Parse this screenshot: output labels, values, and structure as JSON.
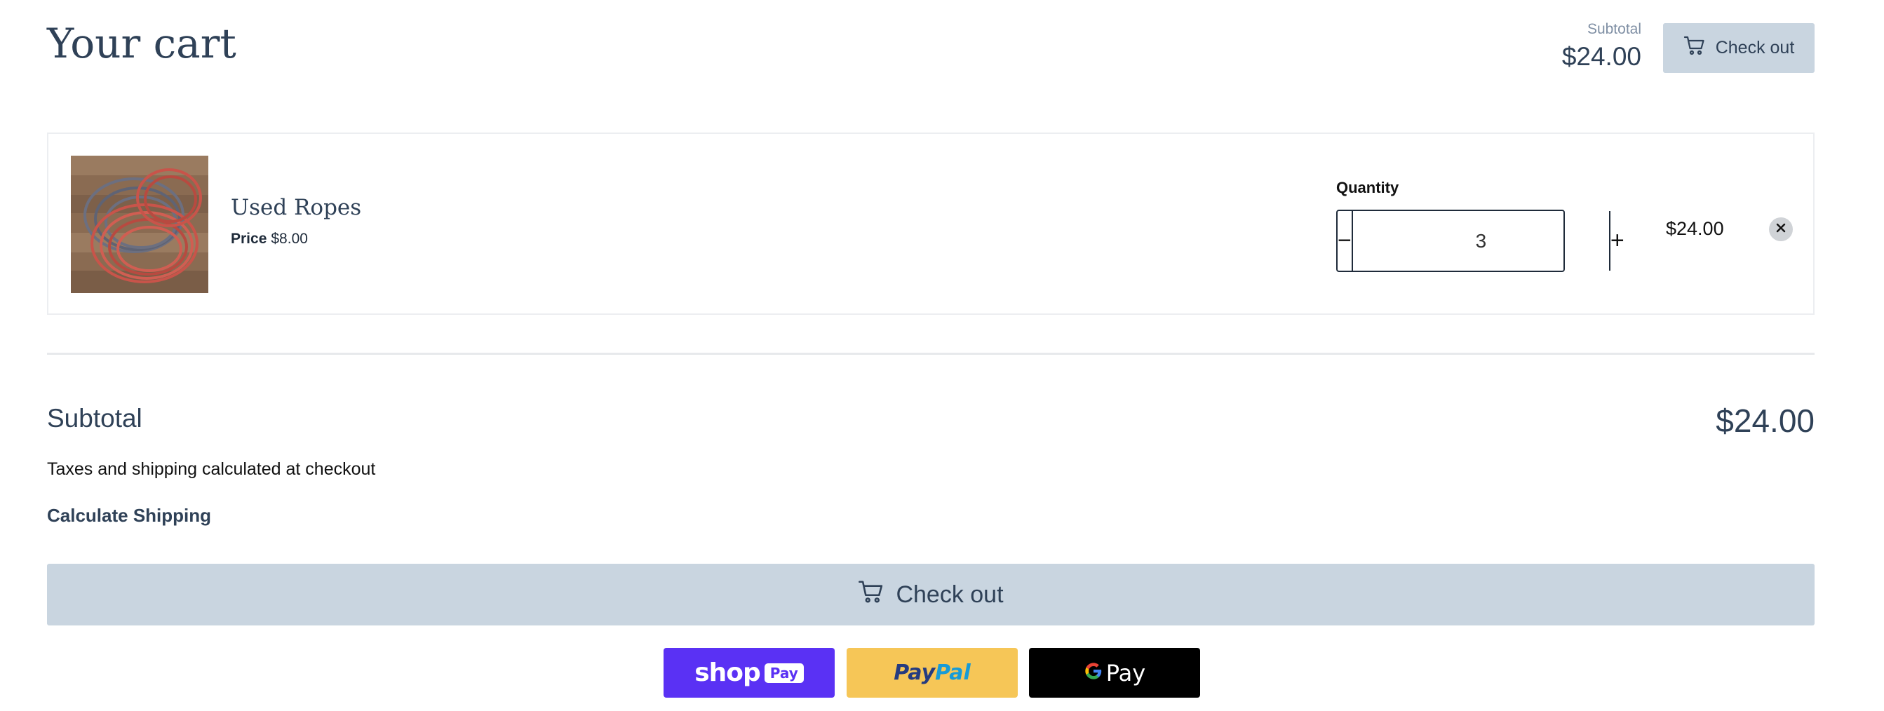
{
  "header": {
    "title": "Your cart",
    "subtotal_label": "Subtotal",
    "subtotal_value": "$24.00",
    "checkout_label": "Check out",
    "checkout_icon": "cart-icon"
  },
  "cart": {
    "items": [
      {
        "title": "Used Ropes",
        "price_label": "Price",
        "price_value": "$8.00",
        "quantity_label": "Quantity",
        "quantity": "3",
        "decrement_symbol": "−",
        "increment_symbol": "+",
        "line_total": "$24.00",
        "remove_icon": "close-icon"
      }
    ]
  },
  "summary": {
    "subtotal_label": "Subtotal",
    "subtotal_value": "$24.00",
    "tax_note": "Taxes and shipping calculated at checkout",
    "calculate_shipping": "Calculate Shipping",
    "checkout_label": "Check out"
  },
  "payment": {
    "shop_pay": {
      "word": "shop",
      "pill": "Pay"
    },
    "paypal": {
      "part1": "Pay",
      "part2": "Pal"
    },
    "google_pay": {
      "g": "G",
      "word": "Pay"
    }
  },
  "colors": {
    "accent": "#c9d5e0",
    "text_primary": "#2f4157",
    "shop_pay": "#5a31f4",
    "paypal": "#f6c657",
    "google_pay": "#000000"
  }
}
